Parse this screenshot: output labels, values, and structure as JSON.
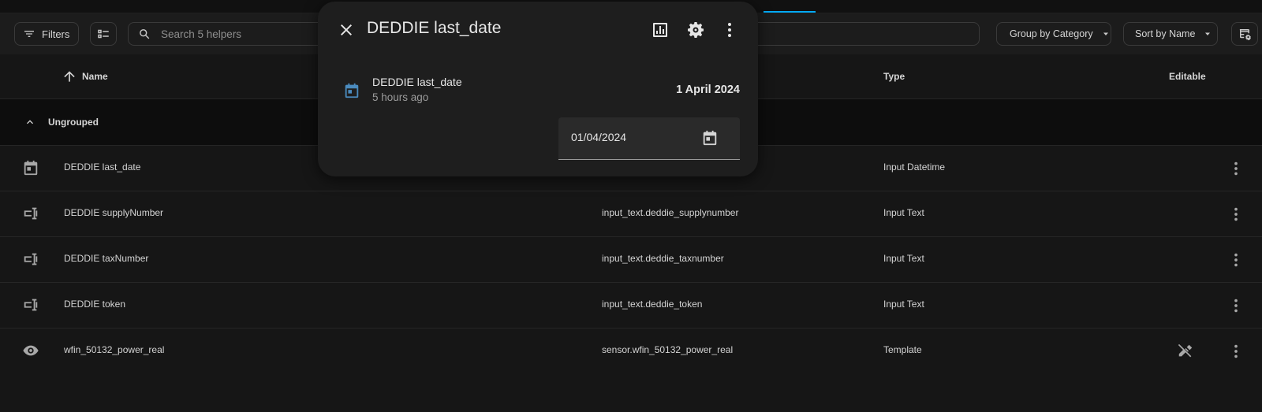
{
  "toolbar": {
    "filters_label": "Filters",
    "search_placeholder": "Search 5 helpers",
    "group_by_label": "Group by Category",
    "sort_by_label": "Sort by Name"
  },
  "table": {
    "columns": {
      "name": "Name",
      "type": "Type",
      "editable": "Editable"
    },
    "group_label": "Ungrouped",
    "rows": [
      {
        "name": "DEDDIE last_date",
        "entity_id": "",
        "type": "Input Datetime",
        "icon": "calendar-icon"
      },
      {
        "name": "DEDDIE supplyNumber",
        "entity_id": "input_text.deddie_supplynumber",
        "type": "Input Text",
        "icon": "form-textbox-icon"
      },
      {
        "name": "DEDDIE taxNumber",
        "entity_id": "input_text.deddie_taxnumber",
        "type": "Input Text",
        "icon": "form-textbox-icon"
      },
      {
        "name": "DEDDIE token",
        "entity_id": "input_text.deddie_token",
        "type": "Input Text",
        "icon": "form-textbox-icon"
      },
      {
        "name": "wfin_50132_power_real",
        "entity_id": "sensor.wfin_50132_power_real",
        "type": "Template",
        "icon": "eye-icon",
        "editable_icon": "pencil-off-icon"
      }
    ]
  },
  "dialog": {
    "title": "DEDDIE last_date",
    "state_name": "DEDDIE last_date",
    "state_time": "5 hours ago",
    "state_value": "1 April 2024",
    "date_value": "01/04/2024"
  },
  "colors": {
    "background": "#111111",
    "surface": "#1c1c1c",
    "dialog": "#1e1e1e",
    "accent": "#03a9f4",
    "calendar_icon": "#4b8bbe"
  }
}
